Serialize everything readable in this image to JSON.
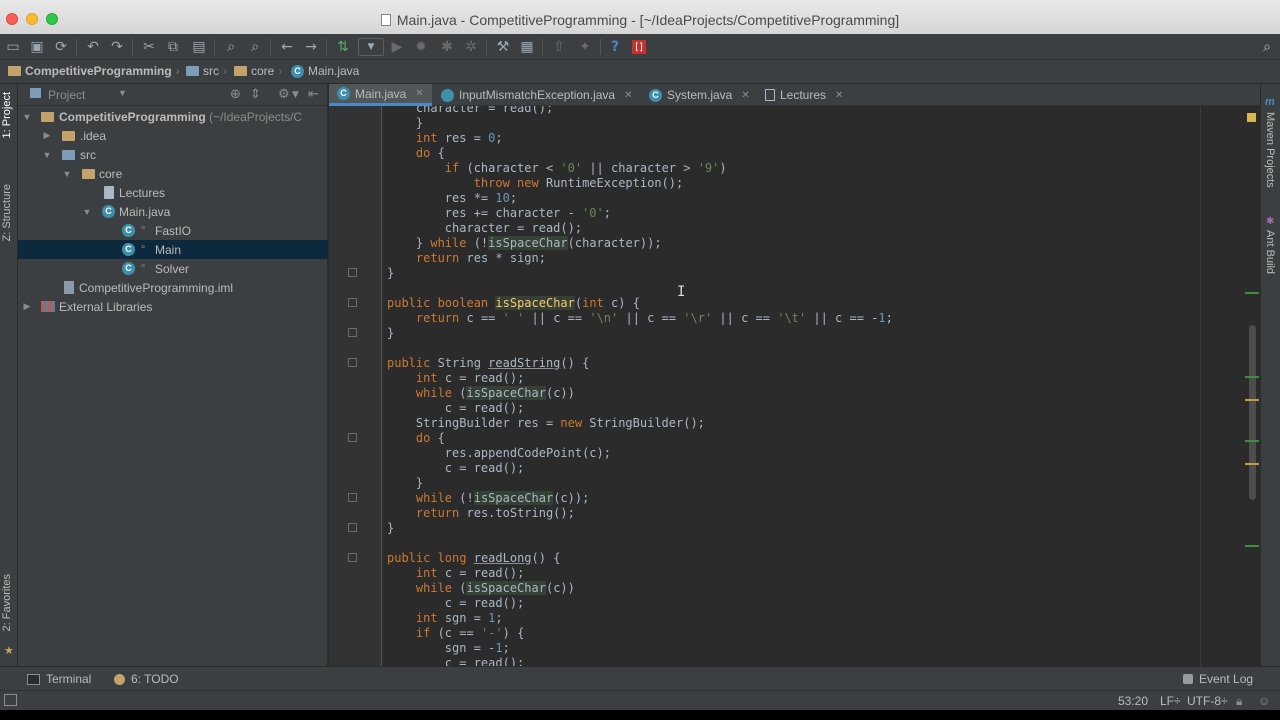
{
  "window": {
    "title": "Main.java - CompetitiveProgramming - [~/IdeaProjects/CompetitiveProgramming]"
  },
  "navbar": {
    "crumbs": [
      "CompetitiveProgramming",
      "src",
      "core",
      "Main.java"
    ]
  },
  "left_strip": {
    "project_tab": "1: Project",
    "structure_tab": "Z: Structure",
    "favorites_tab": "2: Favorites"
  },
  "right_strip": {
    "maven_tab": "Maven Projects",
    "ant_tab": "Ant Build"
  },
  "project_panel": {
    "title": "Project",
    "tree": [
      {
        "label": "CompetitiveProgramming",
        "suffix": "(~/IdeaProjects/C"
      },
      {
        "label": ".idea"
      },
      {
        "label": "src"
      },
      {
        "label": "core"
      },
      {
        "label": "Lectures"
      },
      {
        "label": "Main.java"
      },
      {
        "label": "FastIO"
      },
      {
        "label": "Main"
      },
      {
        "label": "Solver"
      },
      {
        "label": "CompetitiveProgramming.iml"
      },
      {
        "label": "External Libraries"
      }
    ]
  },
  "tabs": [
    {
      "label": "Main.java"
    },
    {
      "label": "InputMismatchException.java"
    },
    {
      "label": "System.java"
    },
    {
      "label": "Lectures"
    }
  ],
  "code": {
    "l0": "    character = read();",
    "l1a": "    }",
    "l2": {
      "a": "    ",
      "kw": "int",
      "b": " res = ",
      "n": "0",
      "c": ";"
    },
    "l3": {
      "a": "    ",
      "kw": "do",
      "b": " {"
    },
    "l4": {
      "a": "        ",
      "kw": "if",
      "b": " (character < ",
      "s1": "'0'",
      "c": " || character > ",
      "s2": "'9'",
      "d": ")"
    },
    "l5": {
      "a": "            ",
      "kw": "throw new",
      "b": " RuntimeException();"
    },
    "l6": {
      "a": "        res *= ",
      "n": "10",
      "b": ";"
    },
    "l7": {
      "a": "        res += character - ",
      "s": "'0'",
      "b": ";"
    },
    "l8": "        character = read();",
    "l9": {
      "a": "    } ",
      "kw": "while",
      "b": " (!",
      "hl": "isSpaceChar",
      "c": "(character));"
    },
    "l10": {
      "a": "    ",
      "kw": "return",
      "b": " res * sign;"
    },
    "l11": "}",
    "l12": {
      "kw1": "public boolean",
      "a": " ",
      "fn": "isSpaceChar",
      "b": "(",
      "kw2": "int",
      "c": " c) {"
    },
    "l13": {
      "a": "    ",
      "kw": "return",
      "b": " c == ",
      "s1": "' '",
      "c": " || c == ",
      "s2": "'\\n'",
      "d": " || c == ",
      "s3": "'\\r'",
      "e": " || c == ",
      "s4": "'\\t'",
      "f": " || c == -",
      "n": "1",
      "g": ";"
    },
    "l14": "}",
    "l15": {
      "kw": "public",
      "a": " String ",
      "u": "readString",
      "b": "() {"
    },
    "l16": {
      "a": "    ",
      "kw": "int",
      "b": " c = read();"
    },
    "l17": {
      "a": "    ",
      "kw": "while",
      "b": " (",
      "hl": "isSpaceChar",
      "c": "(c))"
    },
    "l18": "        c = read();",
    "l19": {
      "a": "    StringBuilder res = ",
      "kw": "new",
      "b": " StringBuilder();"
    },
    "l20": {
      "a": "    ",
      "kw": "do",
      "b": " {"
    },
    "l21": "        res.appendCodePoint(c);",
    "l22": "        c = read();",
    "l23": "    }",
    "l24": {
      "a": "    ",
      "kw": "while",
      "b": " (!",
      "hl": "isSpaceChar",
      "c": "(c));"
    },
    "l25": {
      "a": "    ",
      "kw": "return",
      "b": " res.toString();"
    },
    "l26": "}",
    "l27": {
      "kw": "public long",
      "a": " ",
      "u": "readLong",
      "b": "() {"
    },
    "l28": {
      "a": "    ",
      "kw": "int",
      "b": " c = read();"
    },
    "l29": {
      "a": "    ",
      "kw": "while",
      "b": " (",
      "hl": "isSpaceChar",
      "c": "(c))"
    },
    "l30": "        c = read();",
    "l31": {
      "a": "    ",
      "kw": "int",
      "b": " sgn = ",
      "n": "1",
      "c": ";"
    },
    "l32": {
      "a": "    ",
      "kw": "if",
      "b": " (c == ",
      "s": "'-'",
      "c": ") {"
    },
    "l33": {
      "a": "        sgn = -",
      "n": "1",
      "b": ";"
    },
    "l34": "        c = read();"
  },
  "bottom_bar": {
    "terminal": "Terminal",
    "todo": "6: TODO",
    "event_log": "Event Log"
  },
  "status_bar": {
    "position": "53:20",
    "line_sep": "LF÷",
    "encoding": "UTF-8÷"
  }
}
